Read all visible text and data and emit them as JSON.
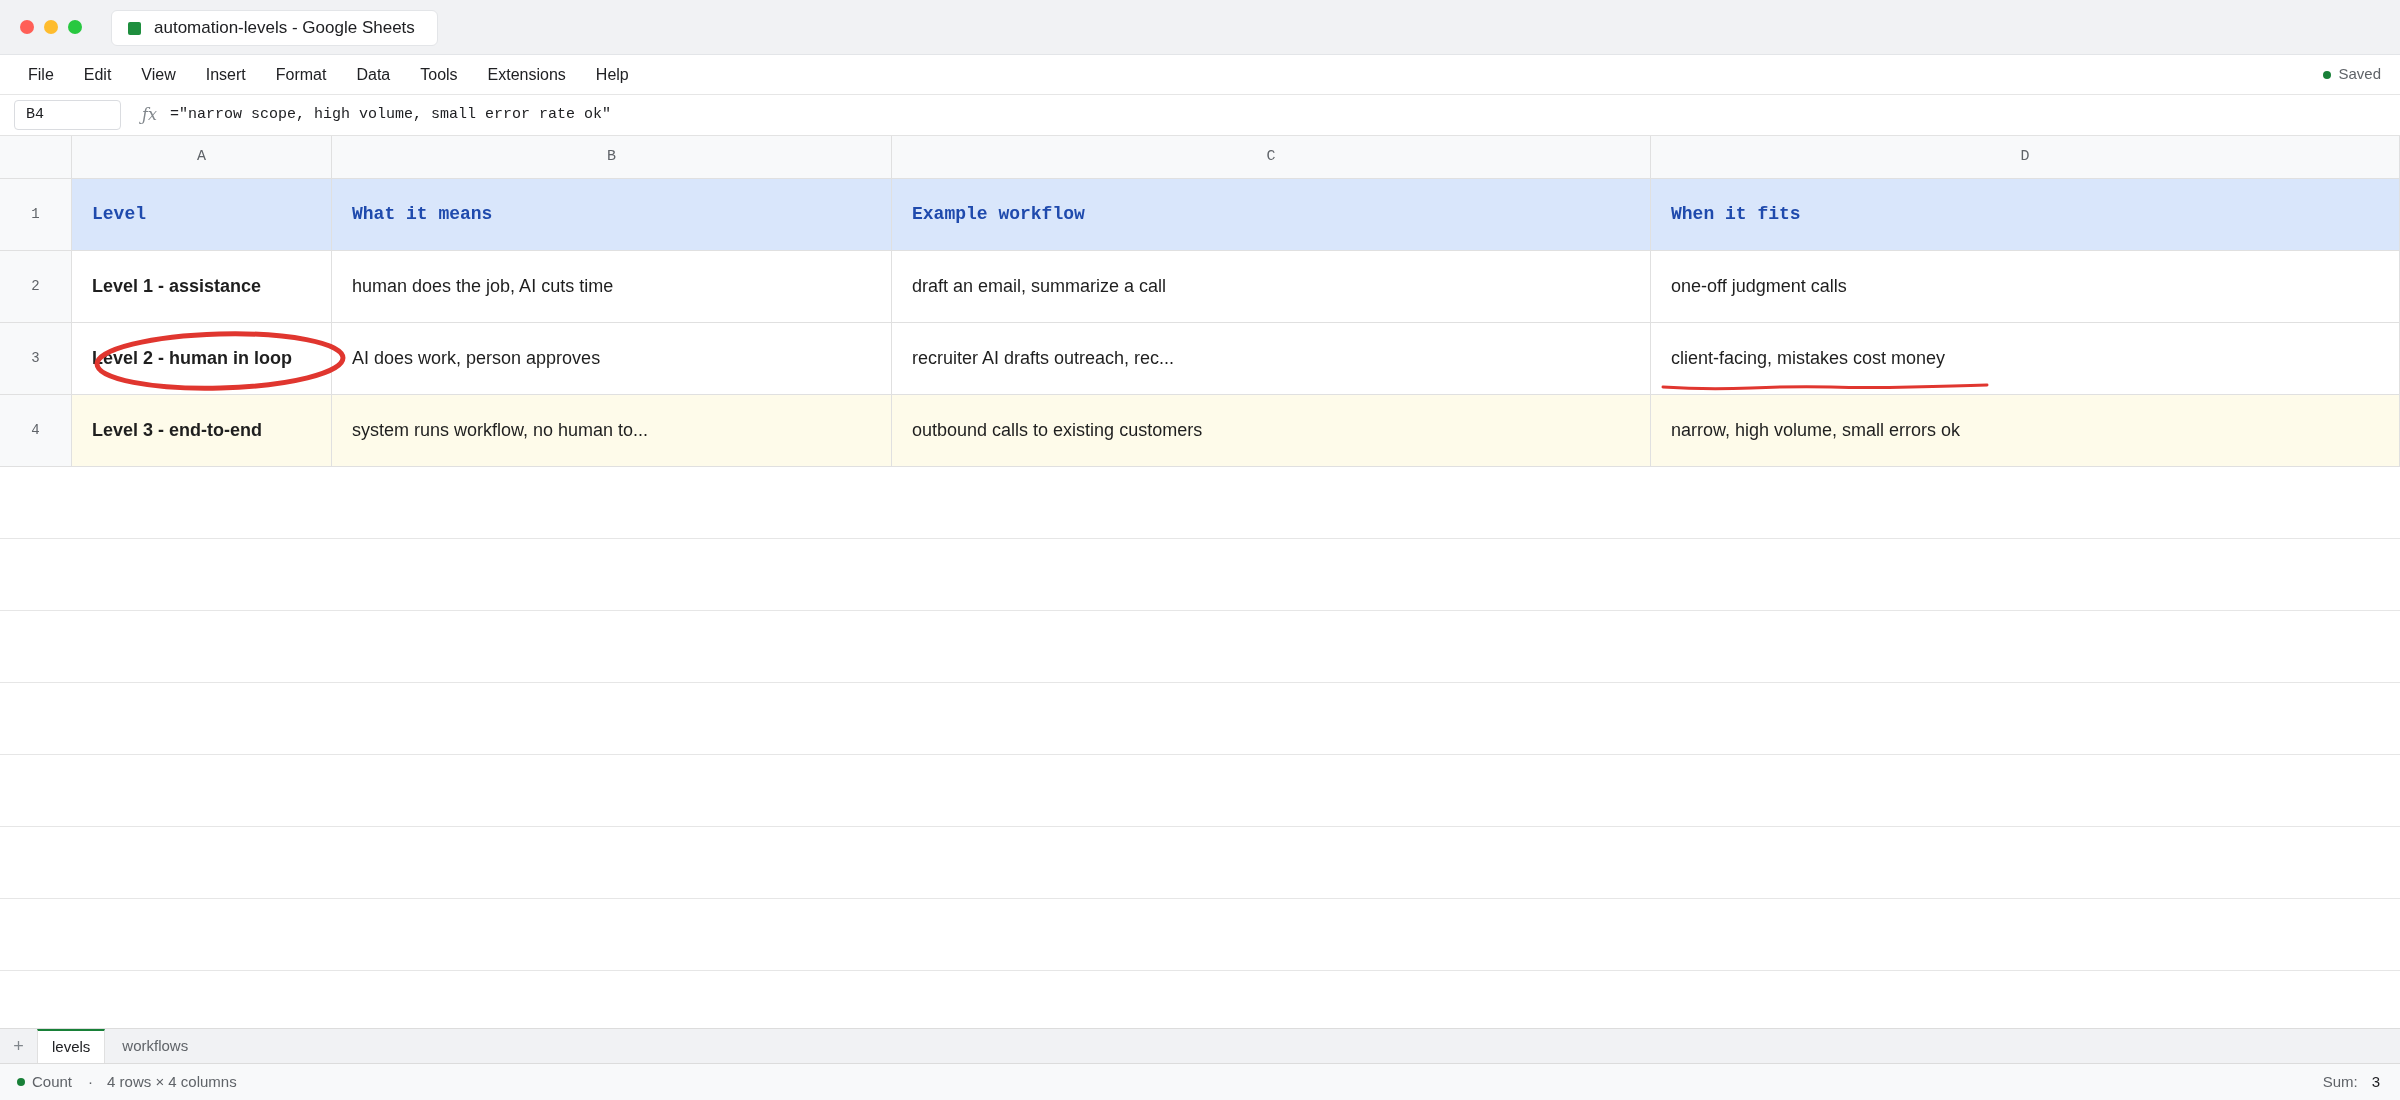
{
  "window": {
    "title": "automation-levels - Google Sheets"
  },
  "menu": [
    "File",
    "Edit",
    "View",
    "Insert",
    "Format",
    "Data",
    "Tools",
    "Extensions",
    "Help"
  ],
  "save_status": "Saved",
  "formula_bar": {
    "cell_ref": "B4",
    "function_symbol": "ƒx",
    "formula": "=\"narrow scope, high volume, small error rate ok\""
  },
  "columns": [
    "A",
    "B",
    "C",
    "D"
  ],
  "rows": [
    {
      "number": "1",
      "kind": "header",
      "highlighted": false,
      "cells": [
        {
          "text": "Level",
          "kind": "plain"
        },
        {
          "text": "What it means",
          "kind": "plain"
        },
        {
          "text": "Example workflow",
          "kind": "plain"
        },
        {
          "text": "When it fits",
          "kind": "plain"
        }
      ]
    },
    {
      "number": "2",
      "kind": "data",
      "highlighted": false,
      "cells": [
        {
          "text": "Level 1 - assistance",
          "kind": "plain"
        },
        {
          "text": "human does the job, AI cuts time",
          "kind": "plain"
        },
        {
          "text": "draft an email, summarize a call",
          "kind": "plain"
        },
        {
          "text": "one-off judgment calls",
          "kind": "plain"
        }
      ]
    },
    {
      "number": "3",
      "kind": "data",
      "highlighted": false,
      "cells": [
        {
          "text": "Level 2 - human in loop",
          "kind": "circled"
        },
        {
          "text": "AI does work, person approves",
          "kind": "plain"
        },
        {
          "text": "recruiter AI drafts outreach, rec...",
          "kind": "plain"
        },
        {
          "text": "client-facing, mistakes cost money",
          "kind": "underlined"
        }
      ]
    },
    {
      "number": "4",
      "kind": "data",
      "highlighted": true,
      "cells": [
        {
          "text": "Level 3 - end-to-end",
          "kind": "plain"
        },
        {
          "text": "system runs workflow, no human to...",
          "kind": "plain"
        },
        {
          "text": "outbound calls to existing customers",
          "kind": "plain"
        },
        {
          "text": "narrow, high volume, small errors ok",
          "kind": "plain"
        }
      ]
    }
  ],
  "sheet_tabs": {
    "add_label": "+",
    "tabs": [
      {
        "label": "levels",
        "selected": true
      },
      {
        "label": "workflows",
        "selected": false
      }
    ]
  },
  "status_bar": {
    "mode": "Count",
    "separator": "·",
    "summary": "4 rows × 4 columns",
    "sum_label": "Sum:",
    "sum_value": "3"
  }
}
